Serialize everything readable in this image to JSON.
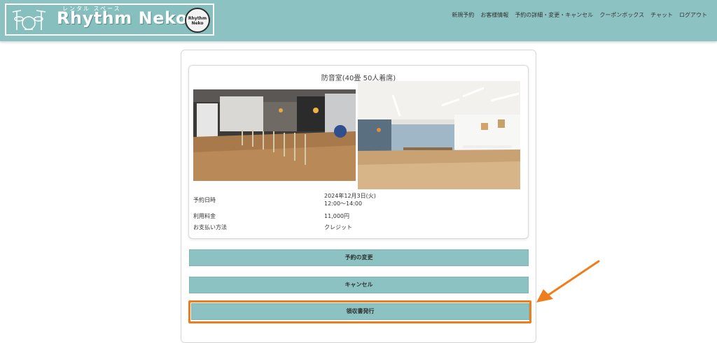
{
  "header": {
    "logo_text": "Rhythm Neko",
    "logo_sub": "レンタル スペース",
    "badge_line1": "Rhythm",
    "badge_line2": "Neko",
    "nav": [
      "新規予約",
      "お客様情報",
      "予約の詳細・変更・キャンセル",
      "クーポンボックス",
      "チャット",
      "ログアウト"
    ]
  },
  "room": {
    "title": "防音室(40畳 50人着席)",
    "rows": [
      {
        "label": "予約日時",
        "value_line1": "2024年12月3日(火)",
        "value_line2": "12:00～14:00"
      },
      {
        "label": "利用料金",
        "value": "11,000円"
      },
      {
        "label": "お支払い方法",
        "value": "クレジット"
      }
    ]
  },
  "buttons": {
    "change": "予約の変更",
    "cancel": "キャンセル",
    "receipt": "領収書発行"
  },
  "colors": {
    "header_bg": "#8cc3c2",
    "button_bg": "#8cc3c2",
    "highlight": "#ef7d1e"
  }
}
